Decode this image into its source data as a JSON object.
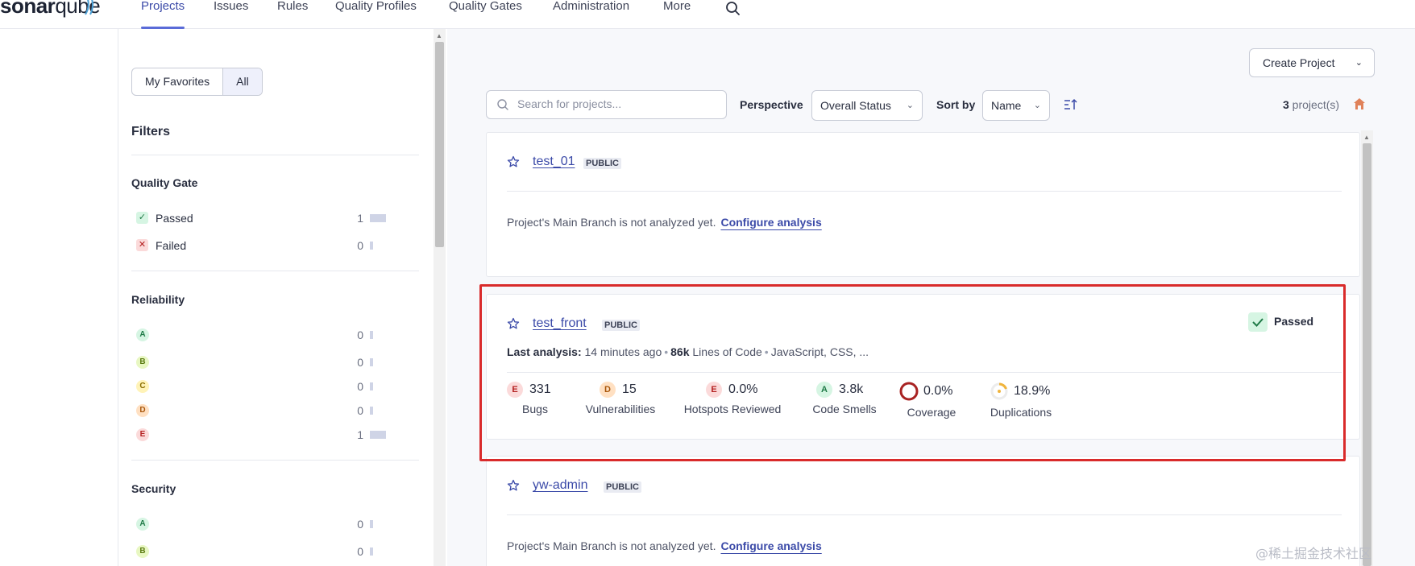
{
  "nav": {
    "logo_bold": "sonar",
    "logo_light": "qube",
    "items": [
      "Projects",
      "Issues",
      "Rules",
      "Quality Profiles",
      "Quality Gates",
      "Administration",
      "More"
    ]
  },
  "sidebar": {
    "toggle": [
      "My Favorites",
      "All"
    ],
    "filters_title": "Filters",
    "quality_gate": {
      "title": "Quality Gate",
      "rows": [
        {
          "label": "Passed",
          "count": "1",
          "fill": 1.0
        },
        {
          "label": "Failed",
          "count": "0",
          "fill": 0.0
        }
      ]
    },
    "reliability": {
      "title": "Reliability",
      "rows": [
        {
          "rating": "A",
          "count": "0",
          "fill": 0.0
        },
        {
          "rating": "B",
          "count": "0",
          "fill": 0.0
        },
        {
          "rating": "C",
          "count": "0",
          "fill": 0.0
        },
        {
          "rating": "D",
          "count": "0",
          "fill": 0.0
        },
        {
          "rating": "E",
          "count": "1",
          "fill": 1.0
        }
      ]
    },
    "security": {
      "title": "Security",
      "rows": [
        {
          "rating": "A",
          "count": "0",
          "fill": 0.0
        },
        {
          "rating": "B",
          "count": "0",
          "fill": 0.0
        }
      ]
    }
  },
  "toolbar": {
    "create_project": "Create Project",
    "search_placeholder": "Search for projects...",
    "perspective_label": "Perspective",
    "perspective_value": "Overall Status",
    "sortby_label": "Sort by",
    "sortby_value": "Name",
    "count_num": "3",
    "count_suffix": " project(s)"
  },
  "projects": [
    {
      "name": "test_01",
      "visibility": "PUBLIC",
      "not_analyzed": "Project's Main Branch is not analyzed yet.",
      "configure": "Configure analysis"
    },
    {
      "name": "test_front",
      "visibility": "PUBLIC",
      "status": "Passed",
      "last_analysis_label": "Last analysis:",
      "last_analysis_value": " 14 minutes ago",
      "loc_value": "86k",
      "loc_label": " Lines of Code",
      "languages": "JavaScript, CSS, ...",
      "metrics": [
        {
          "rating": "E",
          "value": "331",
          "label": "Bugs"
        },
        {
          "rating": "D",
          "value": "15",
          "label": "Vulnerabilities"
        },
        {
          "rating": "E",
          "value": "0.0%",
          "label": "Hotspots Reviewed"
        },
        {
          "rating": "A",
          "value": "3.8k",
          "label": "Code Smells"
        },
        {
          "value": "0.0%",
          "label": "Coverage"
        },
        {
          "value": "18.9%",
          "label": "Duplications"
        }
      ]
    },
    {
      "name": "yw-admin",
      "visibility": "PUBLIC",
      "not_analyzed": "Project's Main Branch is not analyzed yet.",
      "configure": "Configure analysis"
    }
  ],
  "watermark": "@稀土掘金技术社区",
  "colors": {
    "accent": "#3b4aa8",
    "highlight": "#d92b2b",
    "passed": "#1f7a47"
  }
}
